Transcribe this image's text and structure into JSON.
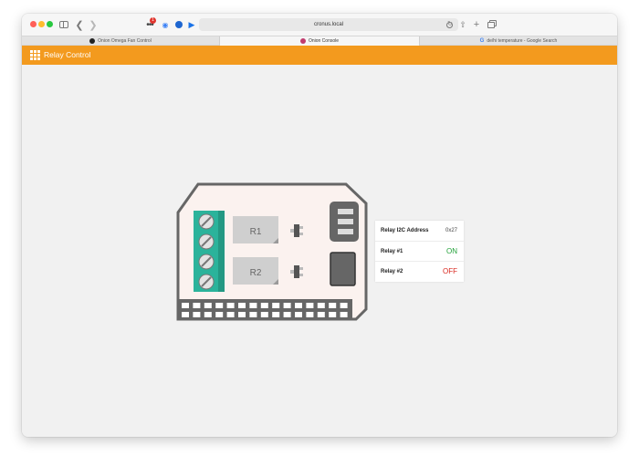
{
  "browser": {
    "address": "cronus.local",
    "extension_badge": "1",
    "tabs": [
      {
        "label": "Onion Omega Fan Control",
        "favicon": "github-icon"
      },
      {
        "label": "Onion Console",
        "favicon": "onion-icon",
        "active": true
      },
      {
        "label": "de/hi temperature - Google Search",
        "favicon": "google-icon"
      }
    ]
  },
  "app": {
    "title": "Relay Control",
    "accent_color": "#f39a1e"
  },
  "board": {
    "relay_1_label": "R1",
    "relay_2_label": "R2"
  },
  "relay_panel": {
    "address_label": "Relay I2C Address",
    "address_value": "0x27",
    "relay_1_label": "Relay #1",
    "relay_1_state": "ON",
    "relay_2_label": "Relay #2",
    "relay_2_state": "OFF",
    "on_color": "#21a038",
    "off_color": "#d9281f"
  }
}
